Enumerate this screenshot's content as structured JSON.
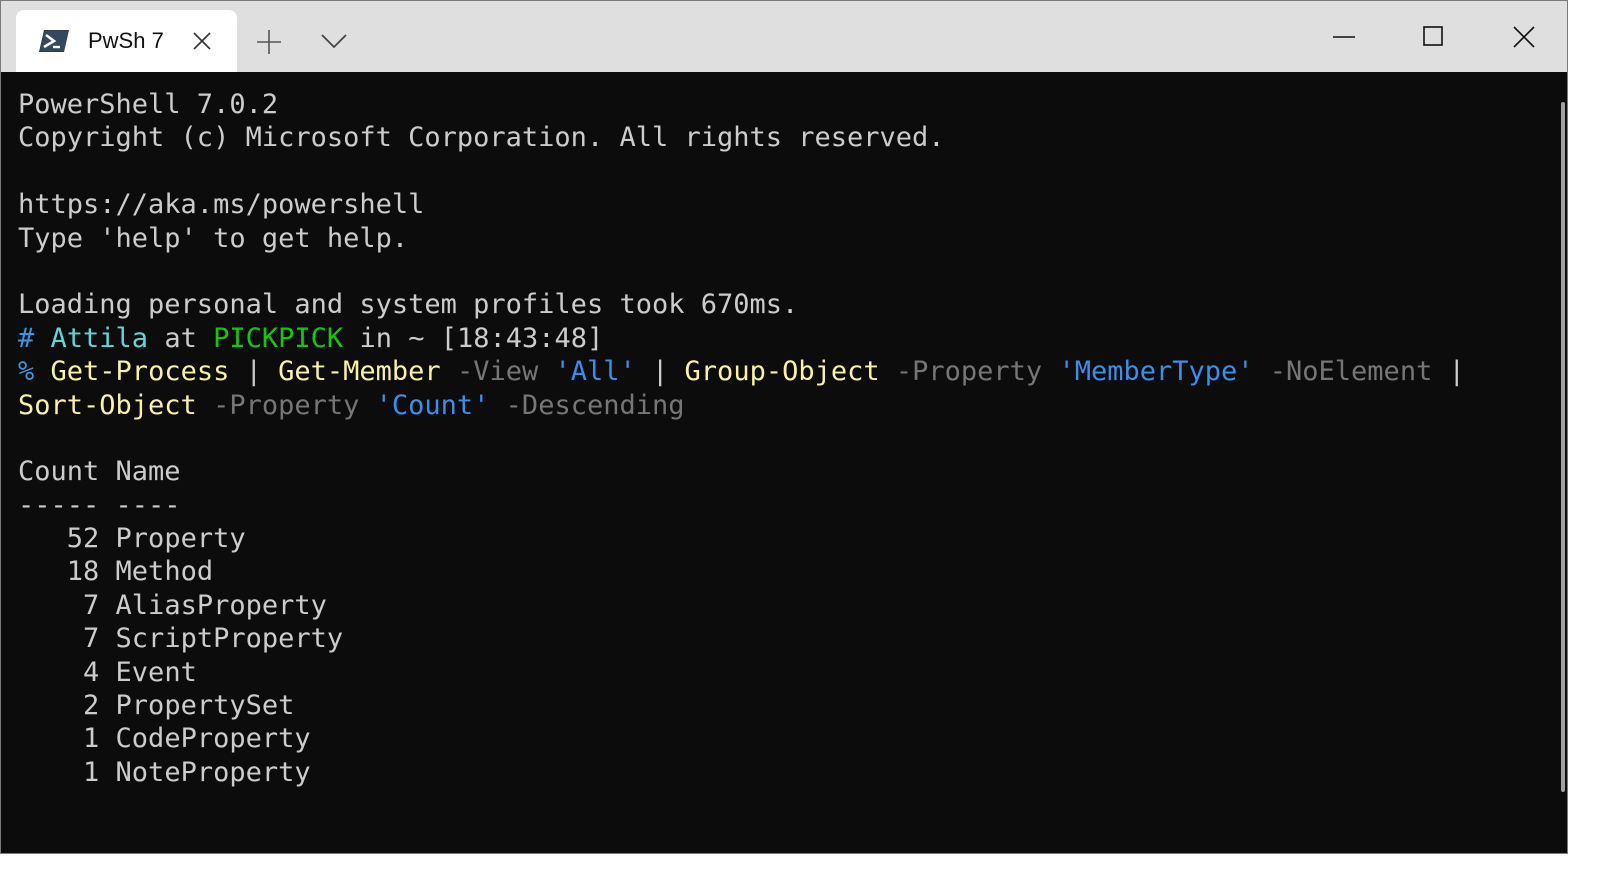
{
  "window": {
    "tab_title": "PwSh 7",
    "tab_icon": "powershell-icon",
    "controls": [
      "minimize-icon",
      "maximize-icon",
      "close-icon"
    ]
  },
  "terminal": {
    "banner": [
      "PowerShell 7.0.2",
      "Copyright (c) Microsoft Corporation. All rights reserved.",
      "",
      "https://aka.ms/powershell",
      "Type 'help' to get help.",
      "",
      "Loading personal and system profiles took 670ms."
    ],
    "prompt": {
      "hash": "#",
      "user": "Attila",
      "at": "at",
      "host": "PICKPICK",
      "in": "in",
      "path": "~",
      "time": "[18:43:48]"
    },
    "command": {
      "sigil": "%",
      "line1": [
        {
          "t": "Get-Process",
          "c": "yellow"
        },
        {
          "t": " | ",
          "c": "plain"
        },
        {
          "t": "Get-Member",
          "c": "yellow"
        },
        {
          "t": " -View ",
          "c": "gray"
        },
        {
          "t": "'All'",
          "c": "str"
        },
        {
          "t": " | ",
          "c": "plain"
        },
        {
          "t": "Group-Object",
          "c": "yellow"
        },
        {
          "t": " -Property ",
          "c": "gray"
        },
        {
          "t": "'MemberType'",
          "c": "str"
        },
        {
          "t": " -NoElement",
          "c": "gray"
        },
        {
          "t": " |",
          "c": "plain"
        }
      ],
      "line2": [
        {
          "t": "Sort-Object",
          "c": "yellow"
        },
        {
          "t": " -Property ",
          "c": "gray"
        },
        {
          "t": "'Count'",
          "c": "str"
        },
        {
          "t": " -Descending",
          "c": "gray"
        }
      ]
    },
    "table": {
      "header": "Count Name",
      "rule": "----- ----",
      "rows": [
        {
          "count": "52",
          "name": "Property"
        },
        {
          "count": "18",
          "name": "Method"
        },
        {
          "count": "7",
          "name": "AliasProperty"
        },
        {
          "count": "7",
          "name": "ScriptProperty"
        },
        {
          "count": "4",
          "name": "Event"
        },
        {
          "count": "2",
          "name": "PropertySet"
        },
        {
          "count": "1",
          "name": "CodeProperty"
        },
        {
          "count": "1",
          "name": "NoteProperty"
        }
      ]
    }
  },
  "colors": {
    "background": "#0c0c0c",
    "foreground": "#cccccc",
    "cmdlet": "#f9f1a5",
    "parameter": "#767676",
    "string": "#3b8eea",
    "host": "#16c60c",
    "user": "#61d6d6"
  }
}
